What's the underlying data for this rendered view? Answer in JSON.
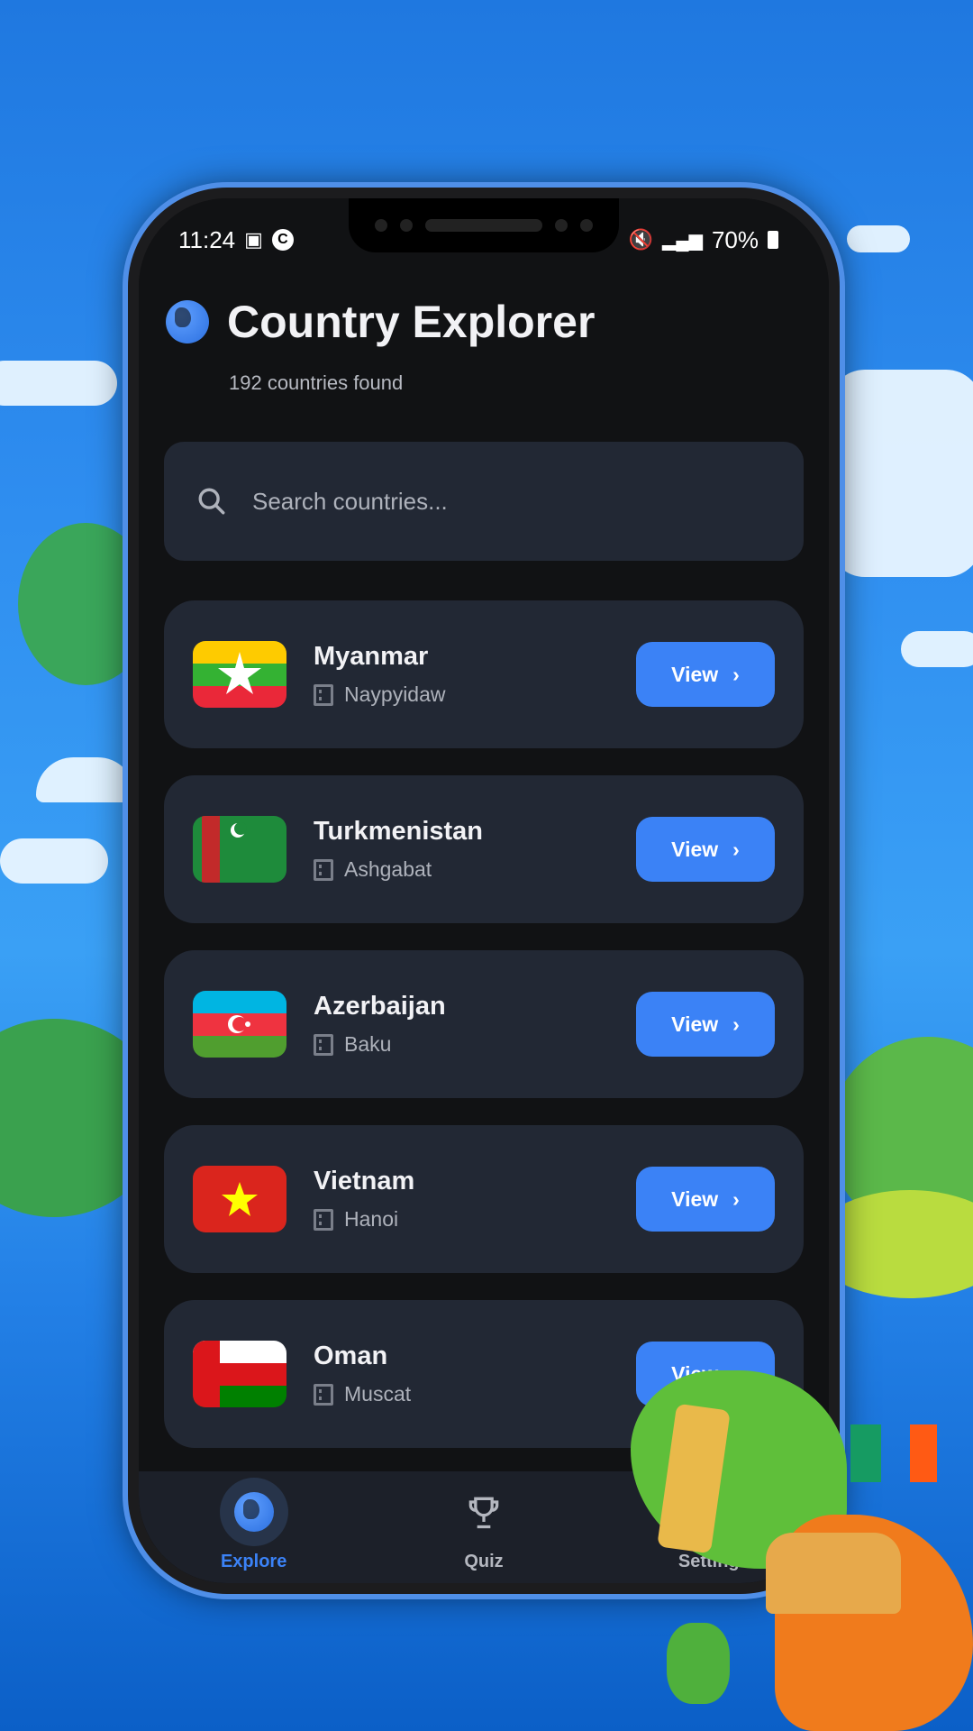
{
  "status_bar": {
    "time": "11:24",
    "battery": "70%"
  },
  "app": {
    "title": "Country Explorer",
    "subtitle": "192 countries found"
  },
  "search": {
    "placeholder": "Search countries..."
  },
  "countries": [
    {
      "name": "Myanmar",
      "capital": "Naypyidaw",
      "button": "View"
    },
    {
      "name": "Turkmenistan",
      "capital": "Ashgabat",
      "button": "View"
    },
    {
      "name": "Azerbaijan",
      "capital": "Baku",
      "button": "View"
    },
    {
      "name": "Vietnam",
      "capital": "Hanoi",
      "button": "View"
    },
    {
      "name": "Oman",
      "capital": "Muscat",
      "button": "View"
    }
  ],
  "nav": {
    "explore": "Explore",
    "quiz": "Quiz",
    "settings": "Settings"
  },
  "colors": {
    "accent": "#3b82f6",
    "card": "#222834",
    "background": "#111214"
  }
}
